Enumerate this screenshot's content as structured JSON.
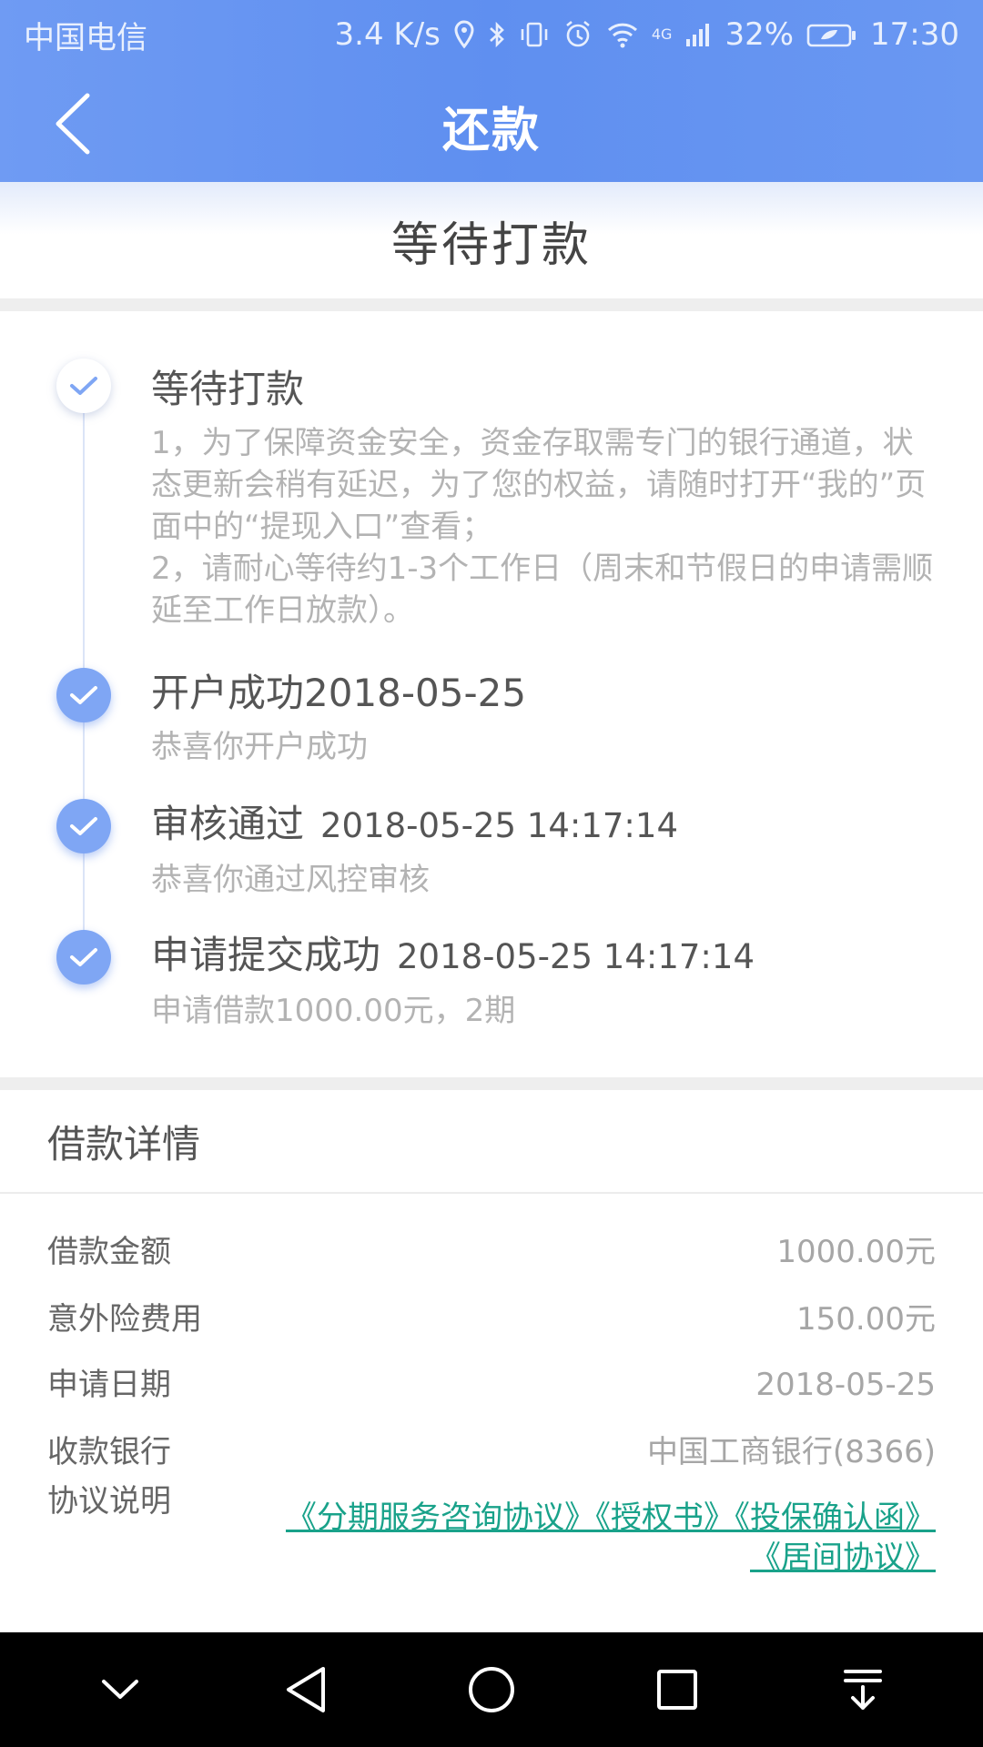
{
  "status_bar": {
    "carrier": "中国电信",
    "speed": "3.4 K/s",
    "network": "4G",
    "battery": "32%",
    "time": "17:30"
  },
  "header": {
    "title": "还款"
  },
  "status": {
    "title": "等待打款"
  },
  "timeline": [
    {
      "title": "等待打款",
      "time": "",
      "desc": "1，为了保障资金安全，资金存取需专门的银行通道，状态更新会稍有延迟，为了您的权益，请随时打开“我的”页面中的“提现入口”查看；",
      "desc2": "2，请耐心等待约1-3个工作日（周末和节假日的申请需顺延至工作日放款）。"
    },
    {
      "title": "开户成功2018-05-25",
      "time": "",
      "desc": "恭喜你开户成功"
    },
    {
      "title": "审核通过",
      "time": "2018-05-25 14:17:14",
      "desc": "恭喜你通过风控审核"
    },
    {
      "title": "申请提交成功",
      "time": "2018-05-25 14:17:14",
      "desc": "申请借款1000.00元，2期"
    }
  ],
  "details": {
    "heading": "借款详情",
    "rows": [
      {
        "label": "借款金额",
        "value": "1000.00元"
      },
      {
        "label": "意外险费用",
        "value": "150.00元"
      },
      {
        "label": "申请日期",
        "value": "2018-05-25"
      },
      {
        "label": "收款银行",
        "value": "中国工商银行(8366)"
      }
    ],
    "agreement_label": "协议说明",
    "agreement_links": "《分期服务咨询协议》《授权书》《投保确认函》《居间协议》"
  },
  "colors": {
    "header": "#5f8ff0",
    "accent": "#7fa6f4",
    "link": "#19a28a"
  }
}
